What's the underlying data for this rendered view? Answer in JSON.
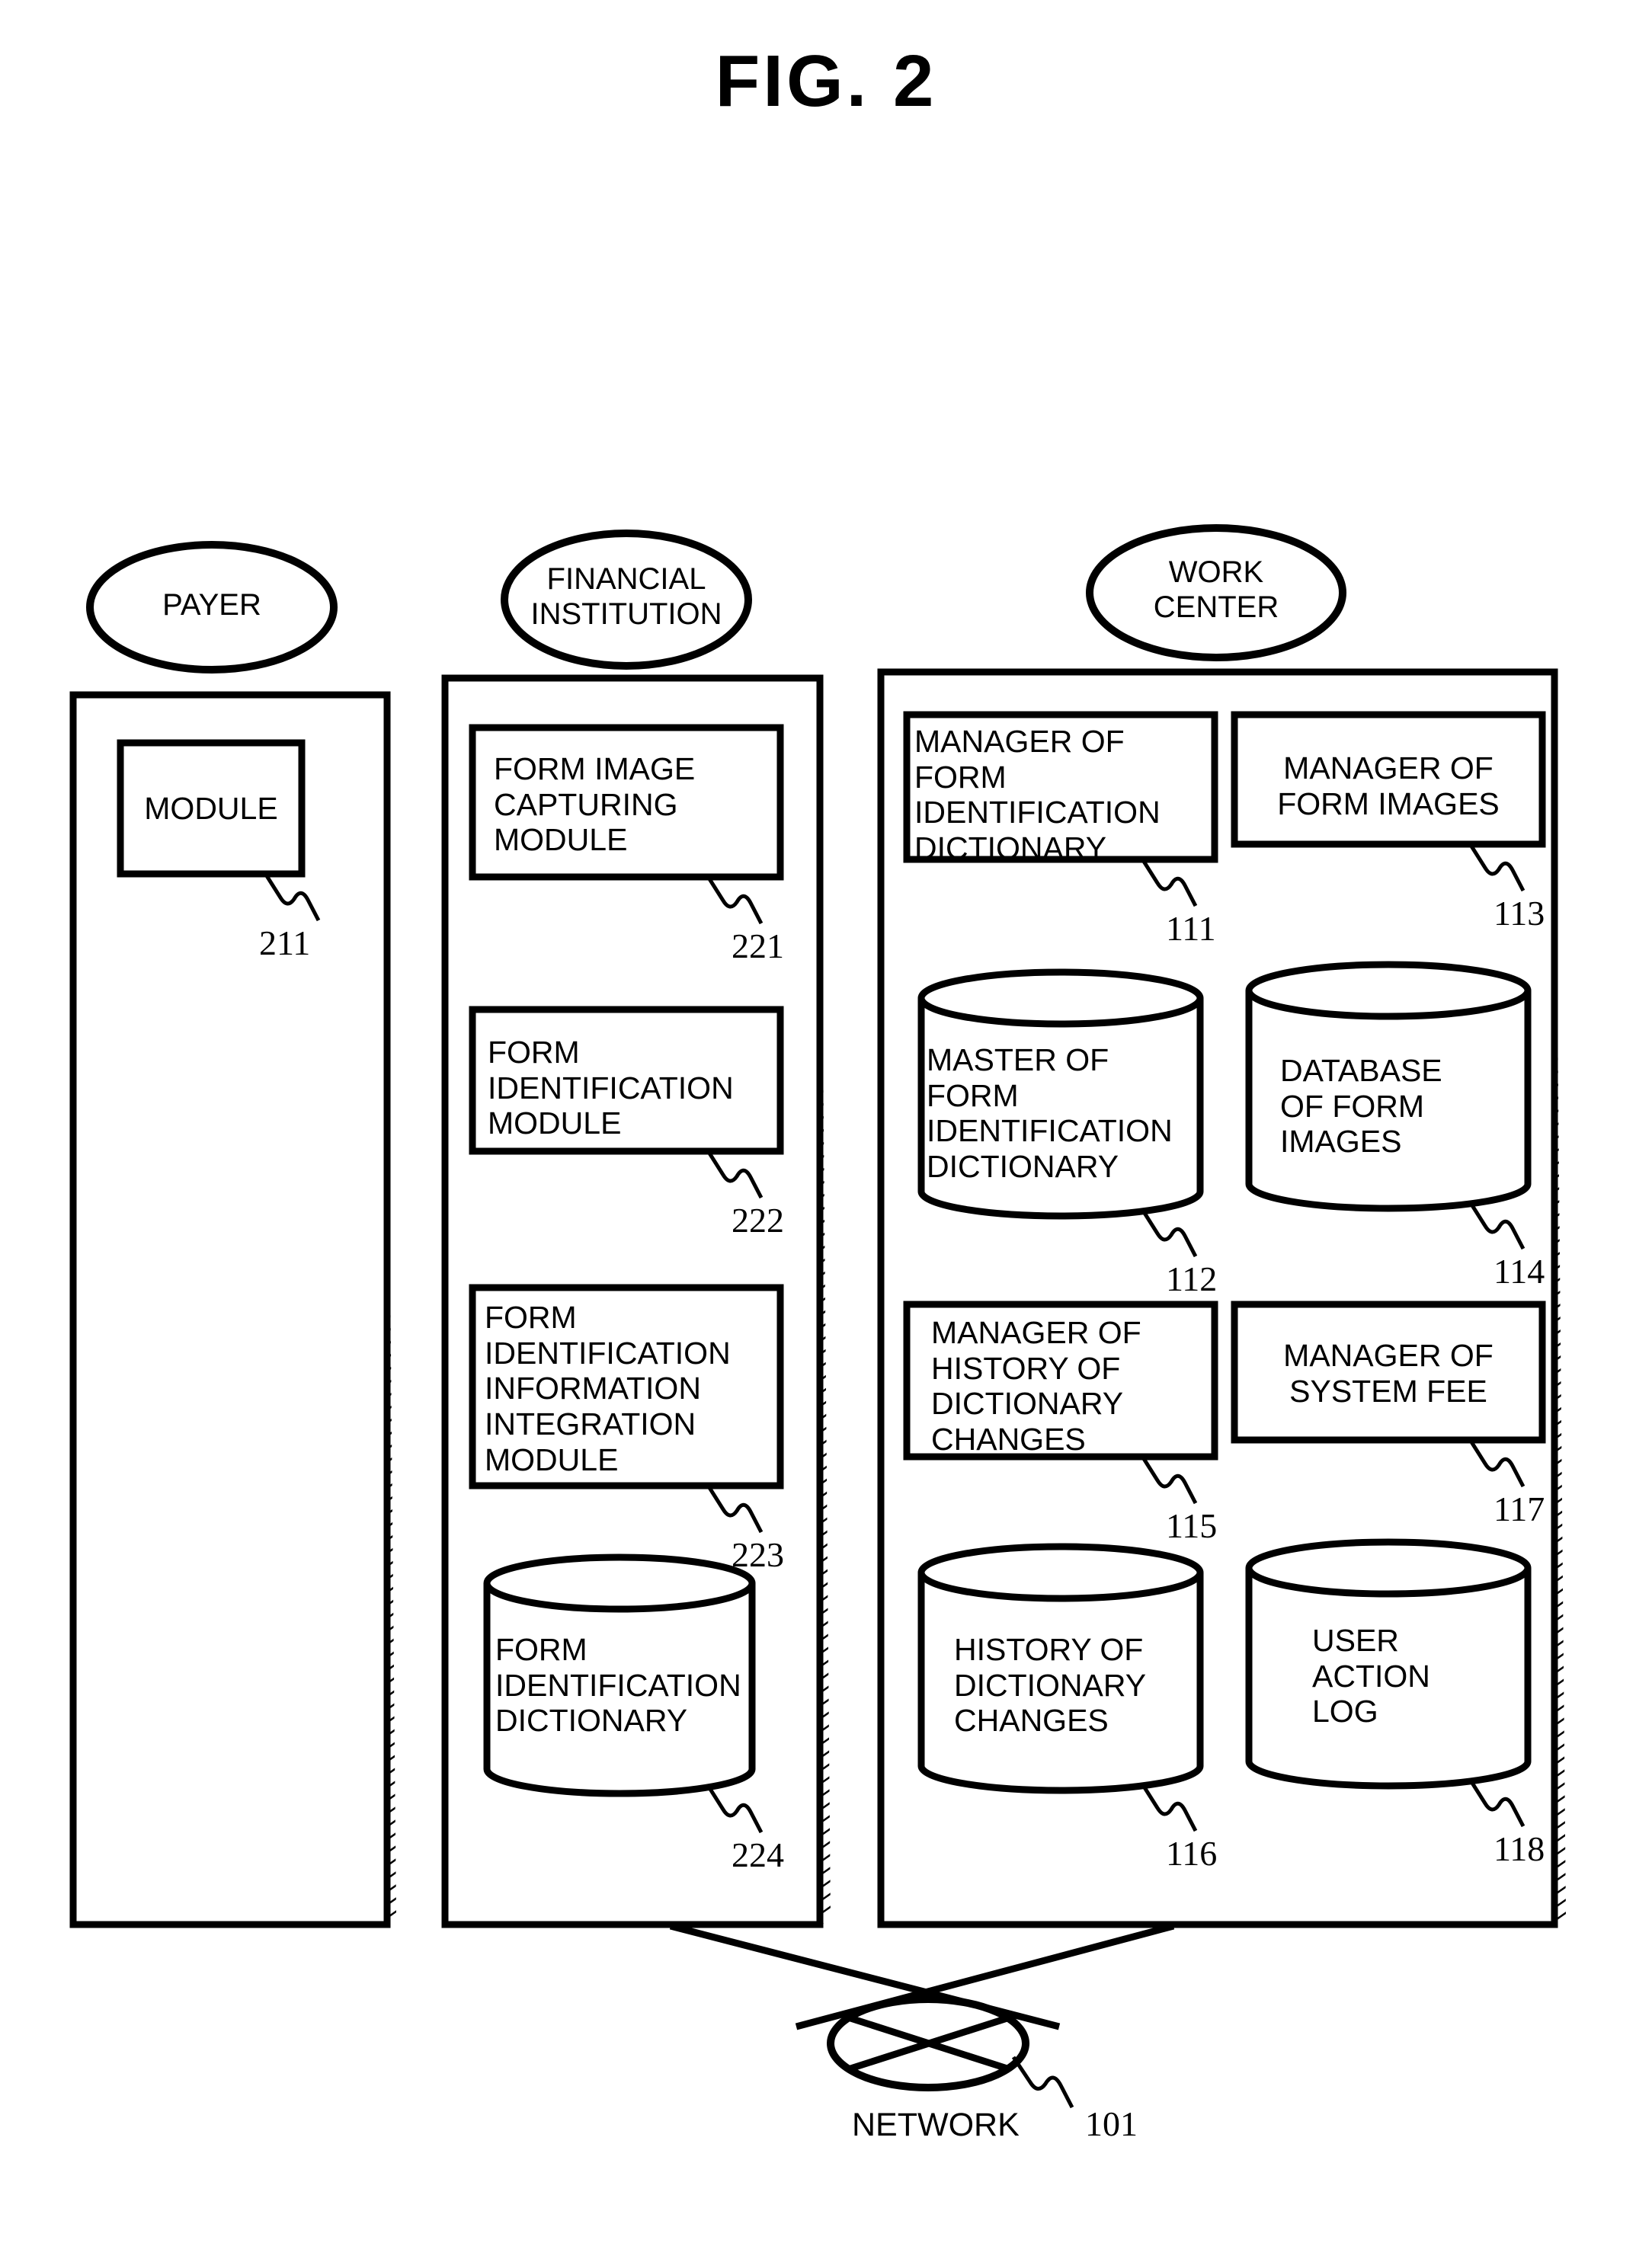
{
  "figure": {
    "title": "FIG. 2"
  },
  "actors": [
    {
      "id": "payer",
      "label": "PAYER"
    },
    {
      "id": "financial-institution",
      "label": "FINANCIAL\nINSTITUTION"
    },
    {
      "id": "work-center",
      "label": "WORK\nCENTER"
    }
  ],
  "panels": {
    "payer": {
      "actor_label": "PAYER",
      "nodes": [
        {
          "id": "module",
          "shape": "rect",
          "label": "MODULE",
          "ref": "211"
        }
      ]
    },
    "financial_institution": {
      "actor_label": "FINANCIAL INSTITUTION",
      "nodes": [
        {
          "id": "form-image-capturing-module",
          "shape": "rect",
          "label": "FORM IMAGE\nCAPTURING\nMODULE",
          "ref": "221"
        },
        {
          "id": "form-identification-module",
          "shape": "rect",
          "label": "FORM\nIDENTIFICATION\nMODULE",
          "ref": "222"
        },
        {
          "id": "form-identification-information-integration-module",
          "shape": "rect",
          "label": "FORM\nIDENTIFICATION\nINFORMATION\nINTEGRATION\nMODULE",
          "ref": "223"
        },
        {
          "id": "form-identification-dictionary",
          "shape": "cylinder",
          "label": "FORM\nIDENTIFICATION\nDICTIONARY",
          "ref": "224"
        }
      ]
    },
    "work_center": {
      "actor_label": "WORK CENTER",
      "nodes": [
        {
          "id": "manager-of-form-identification-dictionary",
          "shape": "rect",
          "label": "MANAGER OF\nFORM\nIDENTIFICATION\nDICTIONARY",
          "ref": "111"
        },
        {
          "id": "manager-of-form-images",
          "shape": "rect",
          "label": "MANAGER OF\nFORM IMAGES",
          "ref": "113"
        },
        {
          "id": "master-of-form-identification-dictionary",
          "shape": "cylinder",
          "label": "MASTER OF\nFORM\nIDENTIFICATION\nDICTIONARY",
          "ref": "112"
        },
        {
          "id": "database-of-form-images",
          "shape": "cylinder",
          "label": "DATABASE\nOF FORM\nIMAGES",
          "ref": "114"
        },
        {
          "id": "manager-of-history-of-dictionary-changes",
          "shape": "rect",
          "label": "MANAGER OF\nHISTORY OF\nDICTIONARY\nCHANGES",
          "ref": "115"
        },
        {
          "id": "manager-of-system-fee",
          "shape": "rect",
          "label": "MANAGER OF\nSYSTEM FEE",
          "ref": "117"
        },
        {
          "id": "history-of-dictionary-changes",
          "shape": "cylinder",
          "label": "HISTORY OF\nDICTIONARY\nCHANGES",
          "ref": "116"
        },
        {
          "id": "user-action-log",
          "shape": "cylinder",
          "label": "USER\nACTION\nLOG",
          "ref": "118"
        }
      ]
    }
  },
  "network": {
    "label": "NETWORK",
    "ref": "101"
  },
  "colors": {
    "stroke": "#000000",
    "background": "#ffffff"
  }
}
